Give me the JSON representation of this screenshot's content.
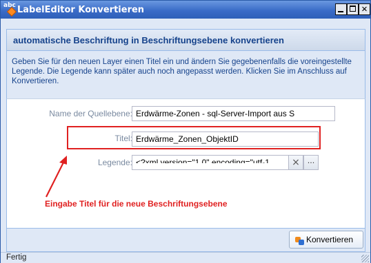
{
  "window": {
    "title": "LabelEditor Konvertieren",
    "icon": "abc-label-icon"
  },
  "header": {
    "title": "automatische Beschriftung in Beschriftungsebene konvertieren"
  },
  "description": "Geben Sie für den neuen Layer einen Titel ein und ändern Sie gegebenenfalls die voreingestellte Legende. Die Legende kann später auch noch angepasst werden. Klicken Sie im Anschluss auf Konvertieren.",
  "form": {
    "source_label": "Name der Quellebene:",
    "source_value": "Erdwärme-Zonen - sql-Server-Import aus S",
    "title_label": "Titel:",
    "title_value": "Erdwärme_Zonen_ObjektID",
    "legend_label": "Legende:",
    "legend_value": "<?xml version=\"1.0\" encoding=\"utf-1",
    "legend_clear": "×",
    "legend_more": "..."
  },
  "annotation": {
    "text": "Eingabe Titel für die neue Beschriftungsebene",
    "color": "#e02020"
  },
  "footer": {
    "convert_label": "Konvertieren"
  },
  "status": {
    "text": "Fertig"
  },
  "colors": {
    "titlebar": "#3a6cc8",
    "panel": "#dfe8f6",
    "header_text": "#15428b"
  }
}
